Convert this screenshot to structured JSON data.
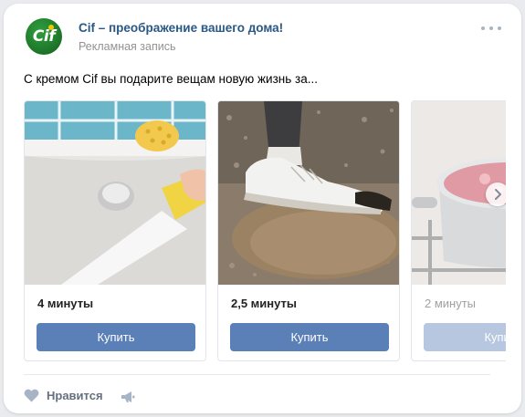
{
  "header": {
    "brand_name": "Cif – преображение вашего дома!",
    "subtitle": "Рекламная запись",
    "logo_text": "Cif"
  },
  "post": {
    "text": "С кремом Cif вы подарите вещам новую жизнь за..."
  },
  "carousel": {
    "slides": [
      {
        "title": "4 минуты",
        "button": "Купить",
        "image": "bathtub-cleaning-photo"
      },
      {
        "title": "2,5 минуты",
        "button": "Купить",
        "image": "sneaker-in-mud-photo"
      },
      {
        "title": "2 минуты",
        "button": "Купить",
        "image": "cooking-pot-photo"
      }
    ]
  },
  "footer": {
    "like_label": "Нравится"
  },
  "colors": {
    "link": "#2a5885",
    "button": "#5b7fb7",
    "brand_green": "#1f7a2c"
  }
}
